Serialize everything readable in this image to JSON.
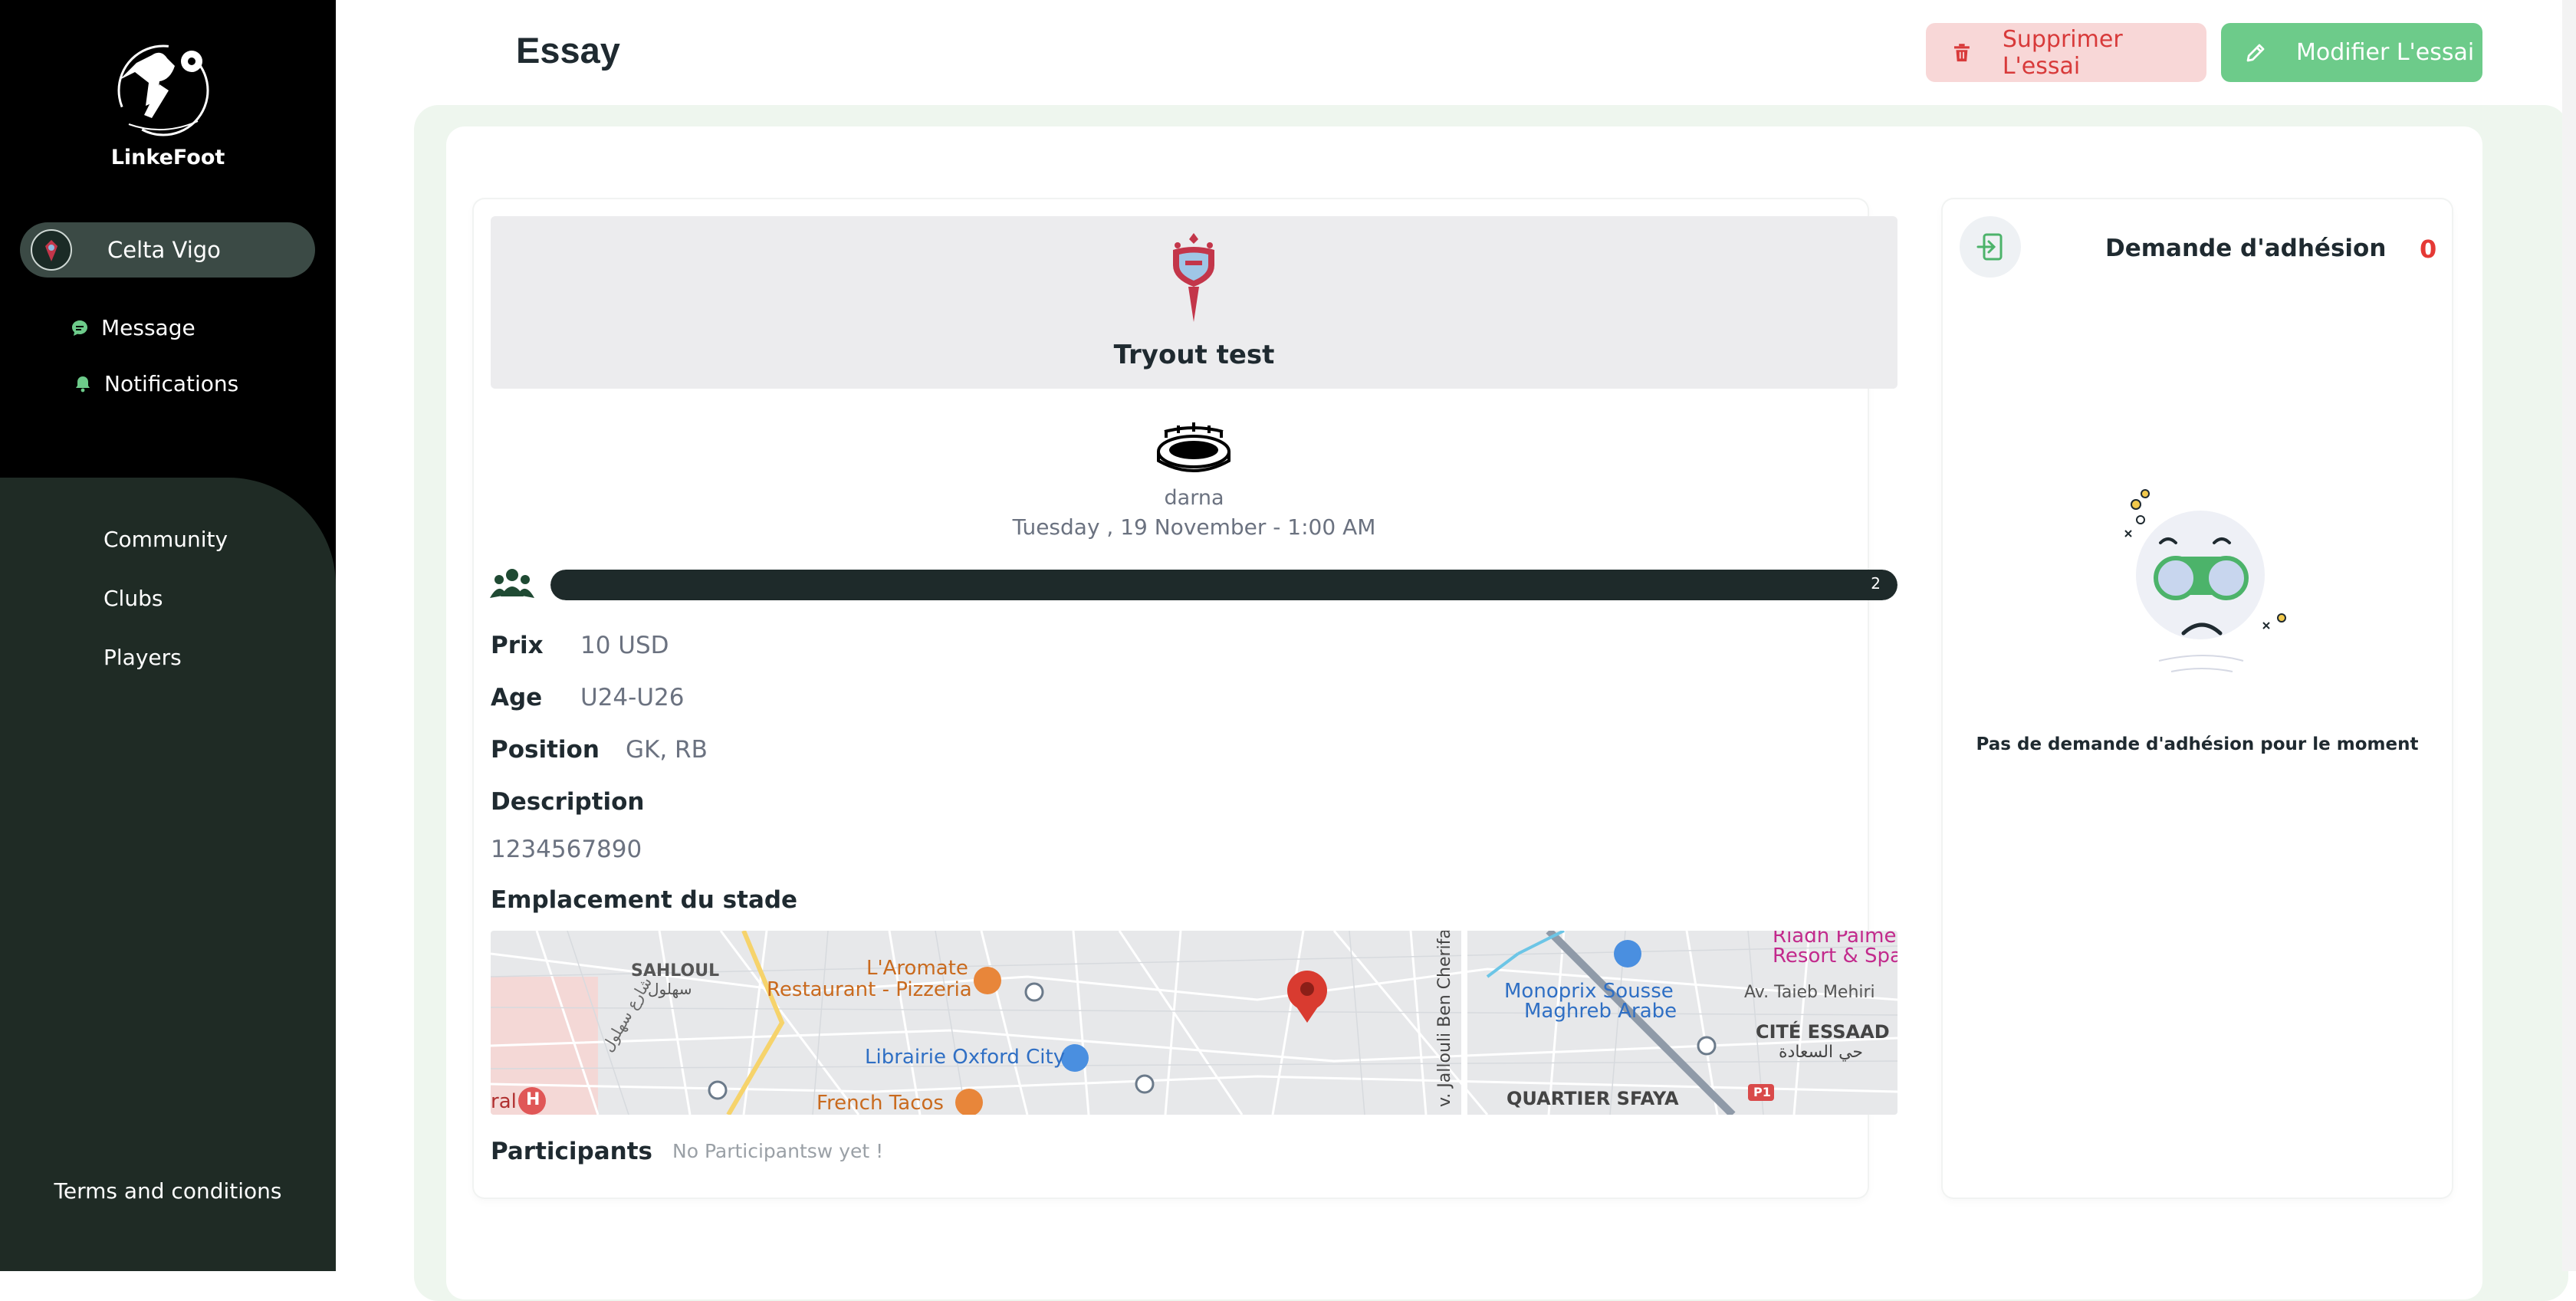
{
  "app": {
    "name": "LinkeFoot"
  },
  "sidebar": {
    "club": "Celta Vigo",
    "top_items": [
      {
        "label": "Message",
        "icon": "chat-icon"
      },
      {
        "label": "Notifications",
        "icon": "bell-icon"
      }
    ],
    "items": [
      {
        "label": "Community"
      },
      {
        "label": "Clubs"
      },
      {
        "label": "Players"
      }
    ],
    "terms": "Terms and conditions"
  },
  "header": {
    "title": "Essay",
    "delete_label": "Supprimer L'essai",
    "edit_label": "Modifier L'essai"
  },
  "tryout": {
    "title": "Tryout test",
    "venue": "darna",
    "datetime": "Tuesday , 19 November - 1:00 AM",
    "participants_count": "2",
    "progress_fraction": 1.0,
    "fields": {
      "price_label": "Prix",
      "price_value": "10 USD",
      "age_label": "Age",
      "age_value": "U24-U26",
      "position_label": "Position",
      "position_value": "GK, RB",
      "description_label": "Description",
      "description_value": "1234567890"
    },
    "stadium_location_label": "Emplacement du stade",
    "participants_label": "Participants",
    "participants_empty": "No Participantsw yet !"
  },
  "map": {
    "labels": {
      "sahloul": "SAHLOUL",
      "sahloul_ar": "سهلول",
      "aromate_1": "L'Aromate",
      "aromate_2": "Restaurant - Pizzeria",
      "librairie": "Librairie Oxford City",
      "french_tacos": "French Tacos",
      "monoprix_1": "Monoprix Sousse",
      "monoprix_2": "Maghreb Arabe",
      "taieb": "Av. Taieb Mehiri",
      "cite": "CITÉ ESSAAD",
      "cite_ar": "حي السعادة",
      "quartier": "QUARTIER SFAYA",
      "riadh_1": "Riadh Palme",
      "riadh_2": "Resort & Spa",
      "jallouli": "v. Jallouli Ben Cherifa",
      "ral": "ral",
      "street_ar": "شارع سهلول",
      "p1": "P1",
      "h": "H"
    },
    "colors": {
      "food": "#e8863a",
      "shop": "#4a8fe0",
      "pin": "#d93b30"
    }
  },
  "join_panel": {
    "title": "Demande d'adhésion",
    "count": "0",
    "empty_text": "Pas de demande d'adhésion pour le moment"
  },
  "colors": {
    "accent_green": "#6dcb8a",
    "danger": "#d83a3a",
    "danger_bg": "#f8d7d7",
    "sidebar_dark": "#1f2b25"
  }
}
